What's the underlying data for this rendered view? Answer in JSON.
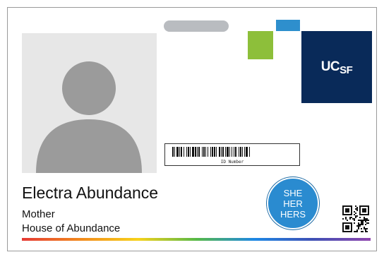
{
  "card": {
    "logo": {
      "text_main": "UC",
      "text_sub": "SF"
    },
    "barcode": {
      "label": "ID Number"
    },
    "person": {
      "name": "Electra Abundance",
      "role": "Mother",
      "organization": "House of Abundance"
    },
    "pronouns": {
      "line1": "SHE",
      "line2": "HER",
      "line3": "HERS"
    },
    "colors": {
      "logo_navy": "#092a59",
      "accent_blue": "#2e8fcd",
      "accent_green": "#8dbf3a",
      "badge_blue": "#2a8bd0",
      "placeholder_gray": "#e7e7e7",
      "pill_gray": "#b9bcc0"
    },
    "icons": {
      "photo": "avatar-placeholder-icon",
      "qr": "qr-code-icon",
      "barcode": "barcode-icon"
    }
  }
}
